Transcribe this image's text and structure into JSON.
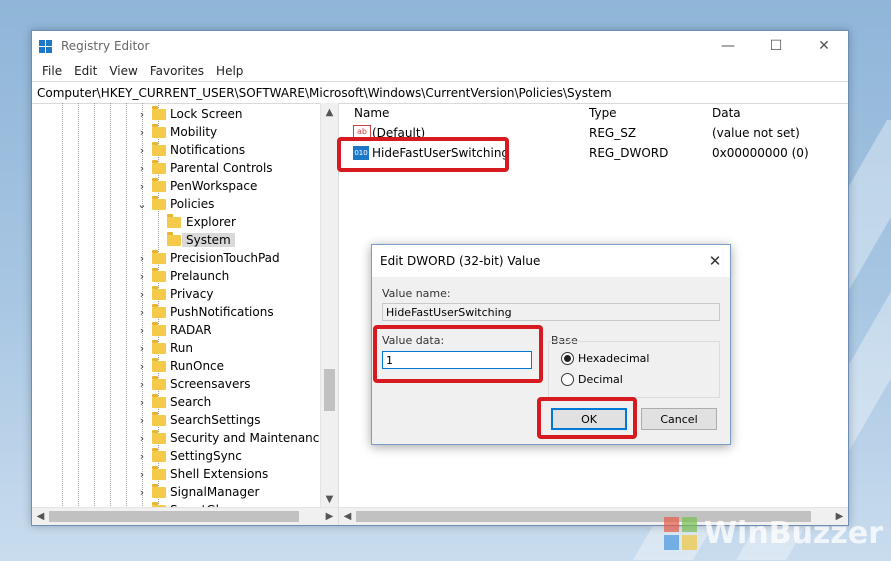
{
  "window": {
    "title": "Registry Editor",
    "controls": {
      "minimize": "—",
      "maximize": "☐",
      "close": "✕"
    }
  },
  "menu": [
    "File",
    "Edit",
    "View",
    "Favorites",
    "Help"
  ],
  "address": "Computer\\HKEY_CURRENT_USER\\SOFTWARE\\Microsoft\\Windows\\CurrentVersion\\Policies\\System",
  "tree": {
    "items": [
      {
        "label": "Lock Screen",
        "chevron": "›"
      },
      {
        "label": "Mobility",
        "chevron": "›"
      },
      {
        "label": "Notifications",
        "chevron": "›"
      },
      {
        "label": "Parental Controls",
        "chevron": "›"
      },
      {
        "label": "PenWorkspace",
        "chevron": "›"
      },
      {
        "label": "Policies",
        "chevron": "⌄"
      },
      {
        "label": "Explorer",
        "chevron": ""
      },
      {
        "label": "System",
        "chevron": "",
        "selected": true
      },
      {
        "label": "PrecisionTouchPad",
        "chevron": "›"
      },
      {
        "label": "Prelaunch",
        "chevron": "›"
      },
      {
        "label": "Privacy",
        "chevron": "›"
      },
      {
        "label": "PushNotifications",
        "chevron": "›"
      },
      {
        "label": "RADAR",
        "chevron": "›"
      },
      {
        "label": "Run",
        "chevron": "›"
      },
      {
        "label": "RunOnce",
        "chevron": "›"
      },
      {
        "label": "Screensavers",
        "chevron": "›"
      },
      {
        "label": "Search",
        "chevron": "›"
      },
      {
        "label": "SearchSettings",
        "chevron": "›"
      },
      {
        "label": "Security and Maintenance",
        "chevron": "›"
      },
      {
        "label": "SettingSync",
        "chevron": "›"
      },
      {
        "label": "Shell Extensions",
        "chevron": "›"
      },
      {
        "label": "SignalManager",
        "chevron": "›"
      },
      {
        "label": "SmartGlass",
        "chevron": "›"
      }
    ]
  },
  "values": {
    "headers": {
      "name": "Name",
      "type": "Type",
      "data": "Data"
    },
    "rows": [
      {
        "name": "(Default)",
        "type": "REG_SZ",
        "data": "(value not set)",
        "icon": "ab"
      },
      {
        "name": "HideFastUserSwitching",
        "type": "REG_DWORD",
        "data": "0x00000000 (0)",
        "icon": "010"
      }
    ]
  },
  "dialog": {
    "title": "Edit DWORD (32-bit) Value",
    "value_name_label": "Value name:",
    "value_name": "HideFastUserSwitching",
    "value_data_label": "Value data:",
    "value_data": "1",
    "base_label": "Base",
    "base_options": [
      {
        "label": "Hexadecimal",
        "checked": true
      },
      {
        "label": "Decimal",
        "checked": false
      }
    ],
    "ok_label": "OK",
    "cancel_label": "Cancel"
  },
  "watermark": "WinBuzzer",
  "colors": {
    "highlight": "#d71920",
    "accent": "#0078d7"
  }
}
